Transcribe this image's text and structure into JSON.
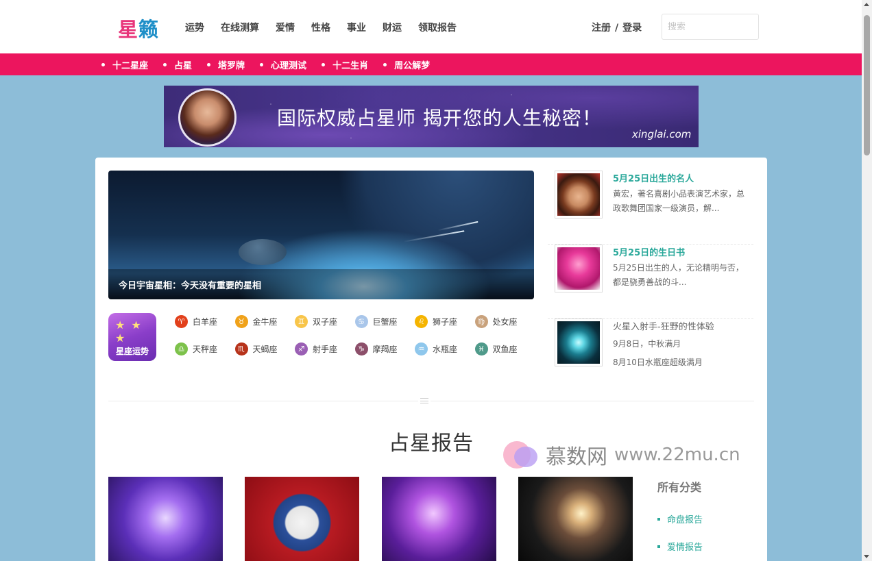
{
  "header": {
    "logo_part1": "星",
    "logo_part2": "籁",
    "nav": [
      "运势",
      "在线测算",
      "爱情",
      "性格",
      "事业",
      "财运",
      "领取报告"
    ],
    "auth_register": "注册",
    "auth_separator": "/",
    "auth_login": "登录",
    "search_placeholder": "搜索"
  },
  "subnav": [
    "十二星座",
    "占星",
    "塔罗牌",
    "心理测试",
    "十二生肖",
    "周公解梦"
  ],
  "banner": {
    "headline": "国际权威占星师  揭开您的人生秘密！",
    "domain": "xinglai.com"
  },
  "feature": {
    "caption": "今日宇宙星相：今天没有重要的星相"
  },
  "zodiac": {
    "logo_text": "星座运势",
    "signs": [
      {
        "name": "白羊座",
        "symbol": "♈",
        "color": "#e2401b"
      },
      {
        "name": "金牛座",
        "symbol": "♉",
        "color": "#f0a21a"
      },
      {
        "name": "双子座",
        "symbol": "♊",
        "color": "#f8c54a"
      },
      {
        "name": "巨蟹座",
        "symbol": "♋",
        "color": "#a9c6ea"
      },
      {
        "name": "狮子座",
        "symbol": "♌",
        "color": "#f5b400"
      },
      {
        "name": "处女座",
        "symbol": "♍",
        "color": "#c9a27c"
      },
      {
        "name": "天秤座",
        "symbol": "♎",
        "color": "#7dc24b"
      },
      {
        "name": "天蝎座",
        "symbol": "♏",
        "color": "#b7331b"
      },
      {
        "name": "射手座",
        "symbol": "♐",
        "color": "#9a5fb4"
      },
      {
        "name": "摩羯座",
        "symbol": "♑",
        "color": "#8c4f6a"
      },
      {
        "name": "水瓶座",
        "symbol": "♒",
        "color": "#8fc7ec"
      },
      {
        "name": "双鱼座",
        "symbol": "♓",
        "color": "#4f9a8a"
      }
    ]
  },
  "side": [
    {
      "title": "5月25日出生的名人",
      "desc": "黄宏，著名喜剧小品表演艺术家，总政歌舞团国家一级演员，解..."
    },
    {
      "title": "5月25日的生日书",
      "desc": "5月25日出生的人，无论精明与否，都是骁勇善战的斗..."
    },
    {
      "title": "火星入射手-狂野的性体验",
      "line2": "9月8日，中秋满月",
      "line3": "8月10日水瓶座超级满月"
    }
  ],
  "section_title": "占星报告",
  "categories": {
    "title": "所有分类",
    "items": [
      "命盘报告",
      "爱情报告"
    ]
  },
  "watermark": {
    "text": "慕数网",
    "url": "www.22mu.cn"
  },
  "colors": {
    "accent_pink": "#ec155e",
    "accent_teal": "#2aa89a",
    "page_background": "#8dbdd8"
  }
}
